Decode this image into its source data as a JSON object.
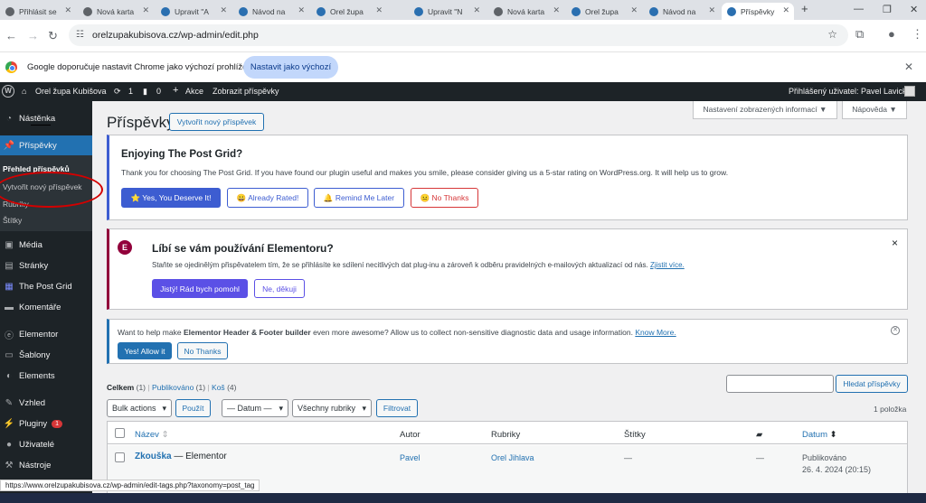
{
  "browser": {
    "tabs": [
      {
        "label": "Přihlásit se"
      },
      {
        "label": "Nová karta"
      },
      {
        "label": "Upravit \"A"
      },
      {
        "label": "Návod na"
      },
      {
        "label": "Orel župa"
      },
      {
        "label": "Upravit \"N"
      },
      {
        "label": "Nová karta"
      },
      {
        "label": "Orel župa"
      },
      {
        "label": "Návod na"
      },
      {
        "label": "Příspěvky"
      }
    ],
    "new_tab": "+",
    "url": "orelzupakubisova.cz/wp-admin/edit.php",
    "infobar": {
      "message": "Google doporučuje nastavit Chrome jako výchozí prohlížeč",
      "button": "Nastavit jako výchozí"
    }
  },
  "adminbar": {
    "site": "Orel župa Kubišova",
    "updates": "1",
    "comments": "0",
    "new": "Akce",
    "view": "Zobrazit příspěvky",
    "user": "Přihlášený uživatel: Pavel Lavický"
  },
  "sidebar": {
    "dashboard": "Nástěnka",
    "posts": "Příspěvky",
    "sub": [
      "Přehled příspěvků",
      "Vytvořit nový příspěvek",
      "Rubriky",
      "Štítky"
    ],
    "media": "Média",
    "pages": "Stránky",
    "postgrid": "The Post Grid",
    "comments": "Komentáře",
    "elementor": "Elementor",
    "templates": "Šablony",
    "elements": "Elements",
    "appearance": "Vzhled",
    "plugins": "Pluginy",
    "plugins_badge": "1",
    "users": "Uživatelé",
    "tools": "Nástroje"
  },
  "page": {
    "title": "Příspěvky",
    "add_new": "Vytvořit nový příspěvek",
    "screen_options": "Nastavení zobrazených informací ▼",
    "help": "Nápověda ▼"
  },
  "postgrid_notice": {
    "title": "Enjoying The Post Grid?",
    "text": "Thank you for choosing The Post Grid. If you have found our plugin useful and makes you smile, please consider giving us a 5-star rating on WordPress.org. It will help us to grow.",
    "btn1": "⭐ Yes, You Deserve It!",
    "btn2": "😀 Already Rated!",
    "btn3": "🔔 Remind Me Later",
    "btn4": "😐 No Thanks"
  },
  "elementor_notice": {
    "title": "Líbí se vám používání Elementoru?",
    "text": "Staňte se ojedinělým přispěvatelem tím, že se přihlásíte ke sdílení necitlivých dat plug-inu a zároveň k odběru pravidelných e-mailových aktualizací od nás.",
    "link": "Zjistit více.",
    "btn1": "Jistý! Rád bych pomohl",
    "btn2": "Ne, děkuji",
    "close": "×"
  },
  "hf_notice": {
    "text1": "Want to help make",
    "bold": "Elementor Header & Footer builder",
    "text2": "even more awesome? Allow us to collect non-sensitive diagnostic data and usage information.",
    "link": "Know More.",
    "btn1": "Yes! Allow it",
    "btn2": "No Thanks"
  },
  "filters": {
    "all": "Celkem",
    "all_count": "(1)",
    "published": "Publikováno",
    "published_count": "(1)",
    "trash": "Koš",
    "trash_count": "(4)",
    "bulk": "Bulk actions",
    "apply": "Použít",
    "date": "— Datum —",
    "cats": "Všechny rubriky",
    "filter": "Filtrovat",
    "search_btn": "Hledat příspěvky",
    "count": "1 položka"
  },
  "table": {
    "headers": {
      "name": "Název",
      "author": "Autor",
      "categories": "Rubriky",
      "tags": "Štítky",
      "date": "Datum"
    },
    "rows": [
      {
        "title": "Zkouška",
        "suffix": "— Elementor",
        "author": "Pavel",
        "category": "Orel Jihlava",
        "tags": "—",
        "comments": "—",
        "status": "Publikováno",
        "date": "26. 4. 2024 (20:15)"
      }
    ]
  },
  "status_url": "https://www.orelzupakubisova.cz/wp-admin/edit-tags.php?taxonomy=post_tag",
  "colors": {
    "wp_blue": "#2271b1",
    "adminbar": "#1d2327",
    "elementor": "#92003b",
    "postgrid_accent": "#3d5dd1"
  }
}
